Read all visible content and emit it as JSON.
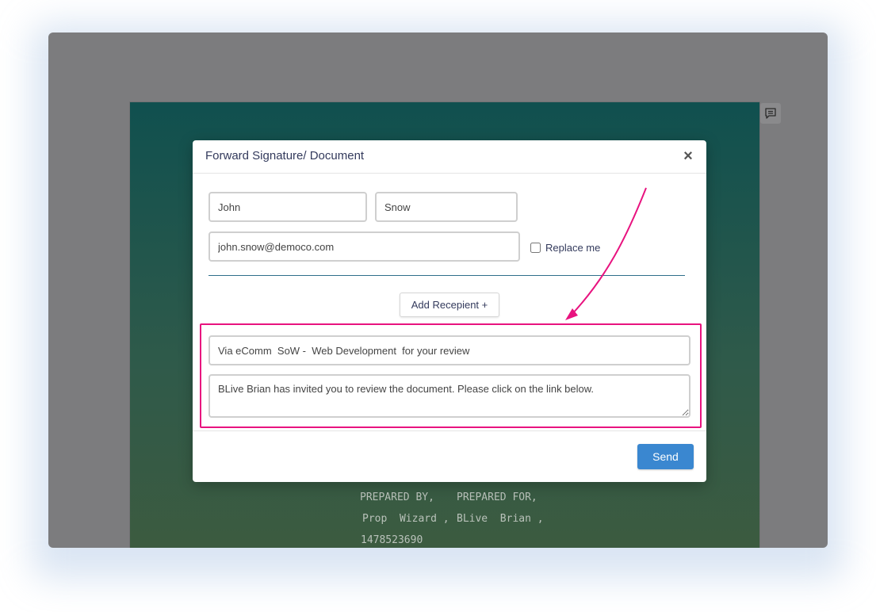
{
  "modal": {
    "title": "Forward Signature/ Document",
    "close_label": "×",
    "first_name": "John",
    "last_name": "Snow",
    "email": "john.snow@democo.com",
    "replace_label": "Replace me",
    "replace_checked": false,
    "add_recipient_label": "Add Recepient +",
    "subject": "Via eComm  SoW -  Web Development  for your review",
    "message": "BLive Brian has invited you to review the document. Please click on the link below.",
    "send_label": "Send"
  },
  "document": {
    "prepared_by_label": "PREPARED BY,",
    "prepared_by_name": "Prop  Wizard ,",
    "prepared_by_phone": "1478523690",
    "prepared_for_label": "PREPARED FOR,",
    "prepared_for_name": "BLive  Brian ,"
  },
  "colors": {
    "annotation": "#e8137f",
    "send_button": "#3a87d0",
    "doc_gradient_top": "#10504f",
    "doc_gradient_bottom": "#3e5b3e"
  },
  "icons": {
    "comment": "comment-icon",
    "close": "close-icon",
    "arrow": "annotation-arrow"
  }
}
